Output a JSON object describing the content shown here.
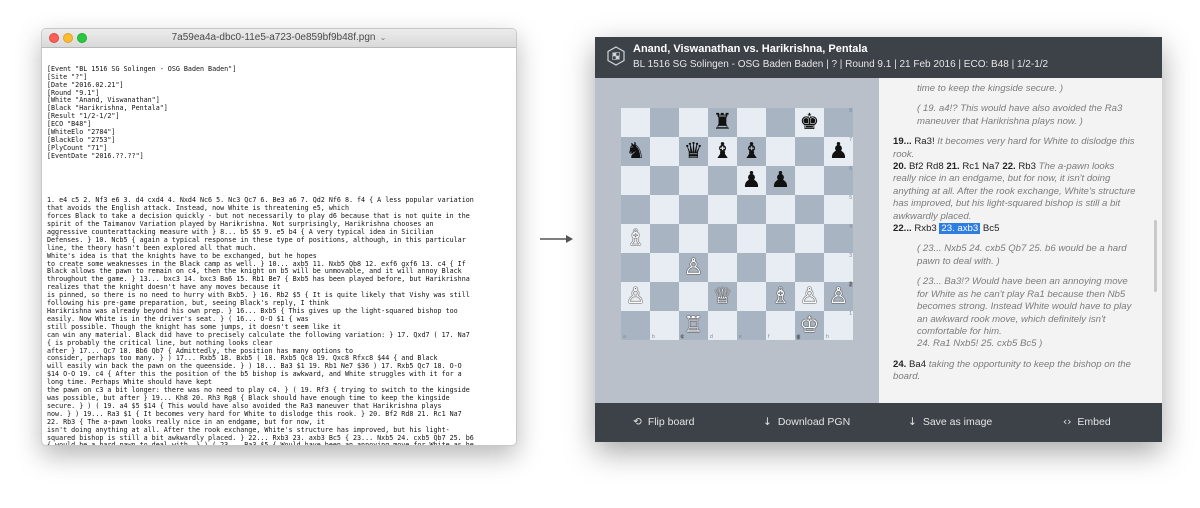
{
  "editor": {
    "filename": "7a59ea4a-dbc0-11e5-a723-0e859bf9b48f.pgn",
    "headers": [
      "[Event \"BL 1516 SG Solingen - OSG Baden Baden\"]",
      "[Site \"?\"]",
      "[Date \"2016.02.21\"]",
      "[Round \"9.1\"]",
      "[White \"Anand, Viswanathan\"]",
      "[Black \"Harikrishna, Pentala\"]",
      "[Result \"1/2-1/2\"]",
      "[ECO \"B48\"]",
      "[WhiteElo \"2784\"]",
      "[BlackElo \"2753\"]",
      "[PlyCount \"71\"]",
      "[EventDate \"2016.??.??\"]"
    ],
    "body": [
      "1. e4 c5 2. Nf3 e6 3. d4 cxd4 4. Nxd4 Nc6 5. Nc3 Qc7 6. Be3 a6 7. Qd2 Nf6 8. f4 { A less popular variation",
      "that avoids the English attack. Instead, now White is threatening e5, which",
      "forces Black to take a decision quickly - but not necessarily to play d6 because that is not quite in the",
      "spirit of the Taimanov Variation played by Harikrishna. Not surprisingly, Harikrishna chooses an",
      "aggressive counterattacking measure with } 8... b5 $5 9. e5 b4 { A very typical idea in Sicilian",
      "Defenses. } 10. Ncb5 { again a typical response in these type of positions, although, in this particular",
      "line, the theory hasn't been explored all that much.",
      "White's idea is that the knights have to be exchanged, but he hopes",
      "to create some weaknesses in the Black camp as well. } 10... axb5 11. Nxb5 Qb8 12. exf6 gxf6 13. c4 { If",
      "Black allows the pawn to remain on c4, then the knight on b5 will be unmovable, and it will annoy Black",
      "throughout the game. } 13... bxc3 14. bxc3 Ba6 15. Rb1 Be7 { Bxb5 has been played before, but Harikrishna",
      "realizes that the knight doesn't have any moves because it",
      "is pinned, so there is no need to hurry with Bxb5. } 16. Rb2 $5 { It is quite likely that Vishy was still",
      "following his pre-game preparation, but, seeing Black's reply, I think",
      "Harikrishna was already beyond his own prep. } 16... Bxb5 { This gives up the light-squared bishop too",
      "easily. Now White is in the driver's seat. } ( 16... O-O $1 { was",
      "still possible. Though the knight has some jumps, it doesn't seem like it",
      "can win any material. Black did have to precisely calculate the following variation: } 17. Qxd7 ( 17. Na7",
      "{ is probably the critical line, but nothing looks clear",
      "after } 17... Qc7 18. Bb6 Qb7 { Admittedly, the position has many options to",
      "consider, perhaps too many. } ) 17... Rxb5 18. Bxb5 ( 18. Rxb5 Qc8 19. Qxc8 Rfxc8 $44 { and Black",
      "will easily win back the pawn on the queenside. } ) 18... Ba3 $1 19. Rb1 Ne7 $36 ) 17. Rxb5 Qc7 18. O-O",
      "$14 O-O 19. c4 { After this the position of the b5 bishop is awkward, and White struggles with it for a",
      "long time. Perhaps White should have kept",
      "the pawn on c3 a bit longer: there was no need to play c4. } ( 19. Rf3 { trying to switch to the kingside",
      "was possible, but after } 19... Kh8 20. Rh3 Rg8 { Black should have enough time to keep the kingside",
      "secure. } ) ( 19. a4 $5 $14 { This would have also avoided the Ra3 maneuver that Harikrishna plays",
      "now. } ) 19... Ra3 $1 { It becomes very hard for White to dislodge this rook. } 20. Bf2 Rd8 21. Rc1 Na7",
      "22. Rb3 { The a-pawn looks really nice in an endgame, but for now, it",
      "isn't doing anything at all. After the rook exchange, White's structure has improved, but his light-",
      "squared bishop is still a bit awkwardly placed. } 22... Rxb3 23. axb3 Bc5 { 23... Nxb5 24. cxb5 Qb7 25. b6",
      "{ would be a hard pawn to deal with. } ) ( 23... Ba3 $5 { Would have been an annoying move for White as he",
      "can't play Ra1 because then Nb5 becomes strong. Instead White would have to play an awkward rook move,",
      "which definitely isn't comfortable for him. } 24. Ra1 Nxb5 $1 25. cxb5 Bc5 ) 24. Ba4 { taking the",
      "opportunity to keep the bishop on the board. } 24... Qb6 $6 { There was no",
      "reason at all for Black to try and force exchanges. Harikrishna seems"
    ]
  },
  "viewer": {
    "title": "Anand, Viswanathan vs. Harikrishna, Pentala",
    "info": "BL 1516 SG Solingen - OSG Baden Baden | ? | Round 9.1 | 21 Feb 2016 | ECO: B48 | 1/2-1/2",
    "board": {
      "ranks": [
        "8",
        "7",
        "6",
        "5",
        "4",
        "3",
        "2",
        "1"
      ],
      "files": [
        "a",
        "b",
        "c",
        "d",
        "e",
        "f",
        "g",
        "h"
      ],
      "position": [
        [
          "",
          "",
          "",
          "♜",
          "",
          "",
          "♚",
          ""
        ],
        [
          "♞",
          "",
          "♛",
          "♝",
          "♝",
          "",
          "",
          "♟"
        ],
        [
          "",
          "",
          "",
          "",
          "♟",
          "♟",
          "",
          ""
        ],
        [
          "",
          "",
          "",
          "",
          "",
          "",
          "",
          ""
        ],
        [
          "♗",
          "",
          "",
          "",
          "",
          "",
          "",
          ""
        ],
        [
          "",
          "",
          "♙",
          "",
          "",
          "",
          "",
          ""
        ],
        [
          "♙",
          "",
          "",
          "♕",
          "",
          "♗",
          "♙",
          "♙"
        ],
        [
          "",
          "",
          "♖",
          "",
          "",
          "",
          "♔",
          ""
        ]
      ]
    },
    "controls": {
      "first": "«",
      "prev": "‹",
      "play": "▶",
      "next": "›",
      "last": "»"
    },
    "moves": {
      "c0": "time to keep the kingside secure. )",
      "v1_open": "( ",
      "v1_num": "19. a4!?",
      "v1_cmt": " This would have also avoided the Ra3 maneuver that Harikrishna plays now. )",
      "m19_num": "19... ",
      "m19_mv": "Ra3!",
      "m19_cmt": " It becomes very hard for White to dislodge this rook.",
      "m20_num": "20.",
      "m20_mv": " Bf2 Rd8 ",
      "m21_num": "21.",
      "m21_mv": " Rc1 Na7 ",
      "m22_num": "22.",
      "m22_mv": " Rb3",
      "m22_cmt": " The a-pawn looks really nice in an endgame, but for now, it isn't doing anything at all. After the rook exchange, White's structure has improved, but his light-squared bishop is still a bit awkwardly placed.",
      "m22b_num": "22...",
      "m22b_mv": " Rxb3 ",
      "m23_hl": "23. axb3",
      "m23_after": " Bc5",
      "v2_open": "( 23... ",
      "v2_a": "Nxb5 ",
      "v2_n24": "24.",
      "v2_b": " cxb5 Qb7 ",
      "v2_n25": "25.",
      "v2_c": " b6",
      "v2_cmt": " would be a hard pawn to deal with. )",
      "v3_open": "( 23... ",
      "v3_a": "Ba3!?",
      "v3_cmt": " Would have been an annoying move for White as he can't play Ra1 because then Nb5 becomes strong. Instead White would have to play an awkward rook move, which definitely isn't comfortable for him.",
      "v3_n24": "24.",
      "v3_b": " Ra1 Nxb5! ",
      "v3_n25": "25.",
      "v3_c": " cxb5 Bc5 )",
      "m24_num": "24.",
      "m24_mv": " Ba4",
      "m24_cmt": " taking the opportunity to keep the bishop on the board."
    },
    "footer": {
      "flip": "Flip board",
      "download": "Download PGN",
      "save": "Save as image",
      "embed": "Embed"
    }
  }
}
